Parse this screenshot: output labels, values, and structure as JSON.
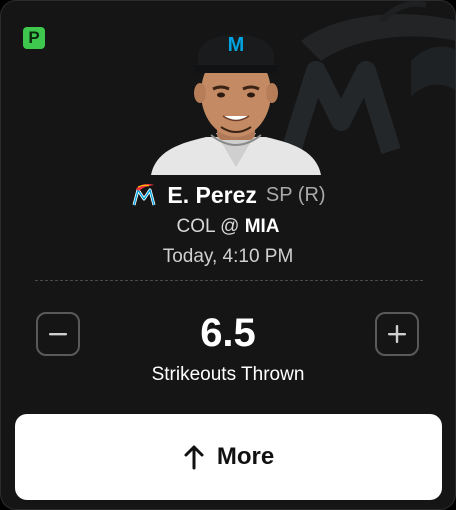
{
  "colors": {
    "card_background": "#151515",
    "badge_green": "#3ec84e",
    "marlins_blue": "#00a3e0",
    "marlins_red": "#ef3340",
    "button_white": "#ffffff"
  },
  "badge": {
    "label": "P"
  },
  "player": {
    "name": "E. Perez",
    "position": "SP (R)",
    "team_logo_icon": "marlins-logo-icon"
  },
  "game": {
    "away": "COL",
    "separator": "@",
    "home": "MIA",
    "time": "Today, 4:10 PM"
  },
  "prop": {
    "line": "6.5",
    "stat": "Strikeouts Thrown",
    "decrease_icon": "minus-icon",
    "increase_icon": "plus-icon"
  },
  "action": {
    "label": "More",
    "icon": "arrow-up-icon"
  }
}
